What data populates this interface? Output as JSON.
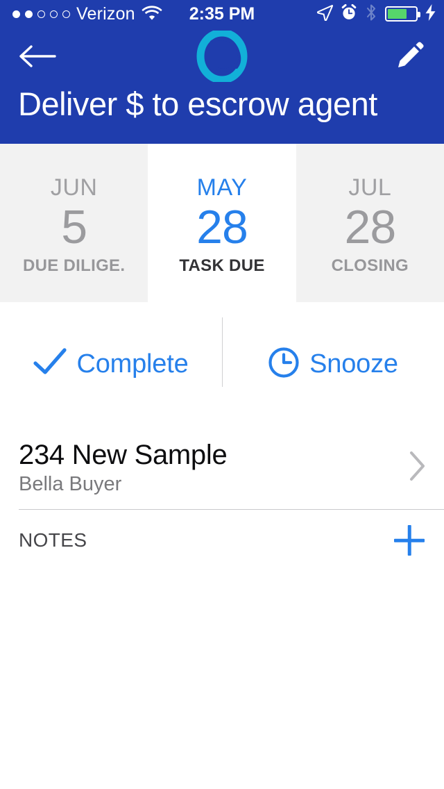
{
  "status_bar": {
    "carrier": "Verizon",
    "time": "2:35 PM",
    "signal_dots_filled": 2,
    "signal_dots_total": 5,
    "wifi_icon": "wifi-icon",
    "location_icon": "location-arrow-icon",
    "alarm_icon": "alarm-clock-icon",
    "bluetooth_icon": "bluetooth-icon",
    "battery_icon": "battery-icon",
    "battery_percent": 70,
    "charging_icon": "lightning-bolt-icon",
    "background_color": "#1f3dad",
    "text_color": "#ffffff"
  },
  "nav_bar": {
    "back_icon": "back-arrow-icon",
    "logo_icon": "app-logo-ring-icon",
    "logo_color": "#12b0d8",
    "edit_icon": "pencil-icon",
    "background_color": "#1f3dad"
  },
  "header": {
    "title": "Deliver $ to escrow agent"
  },
  "date_tabs": [
    {
      "month": "JUN",
      "day": "5",
      "label": "DUE DILIGE.",
      "active": false
    },
    {
      "month": "MAY",
      "day": "28",
      "label": "TASK DUE",
      "active": true
    },
    {
      "month": "JUL",
      "day": "28",
      "label": "CLOSING",
      "active": false
    }
  ],
  "actions": {
    "complete": {
      "label": "Complete",
      "icon": "checkmark-icon"
    },
    "snooze": {
      "label": "Snooze",
      "icon": "clock-icon"
    },
    "accent_color": "#2680eb"
  },
  "property": {
    "title": "234 New Sample",
    "subtitle": "Bella Buyer",
    "chevron_icon": "chevron-right-icon"
  },
  "notes": {
    "label": "NOTES",
    "add_icon": "plus-icon",
    "items": []
  }
}
